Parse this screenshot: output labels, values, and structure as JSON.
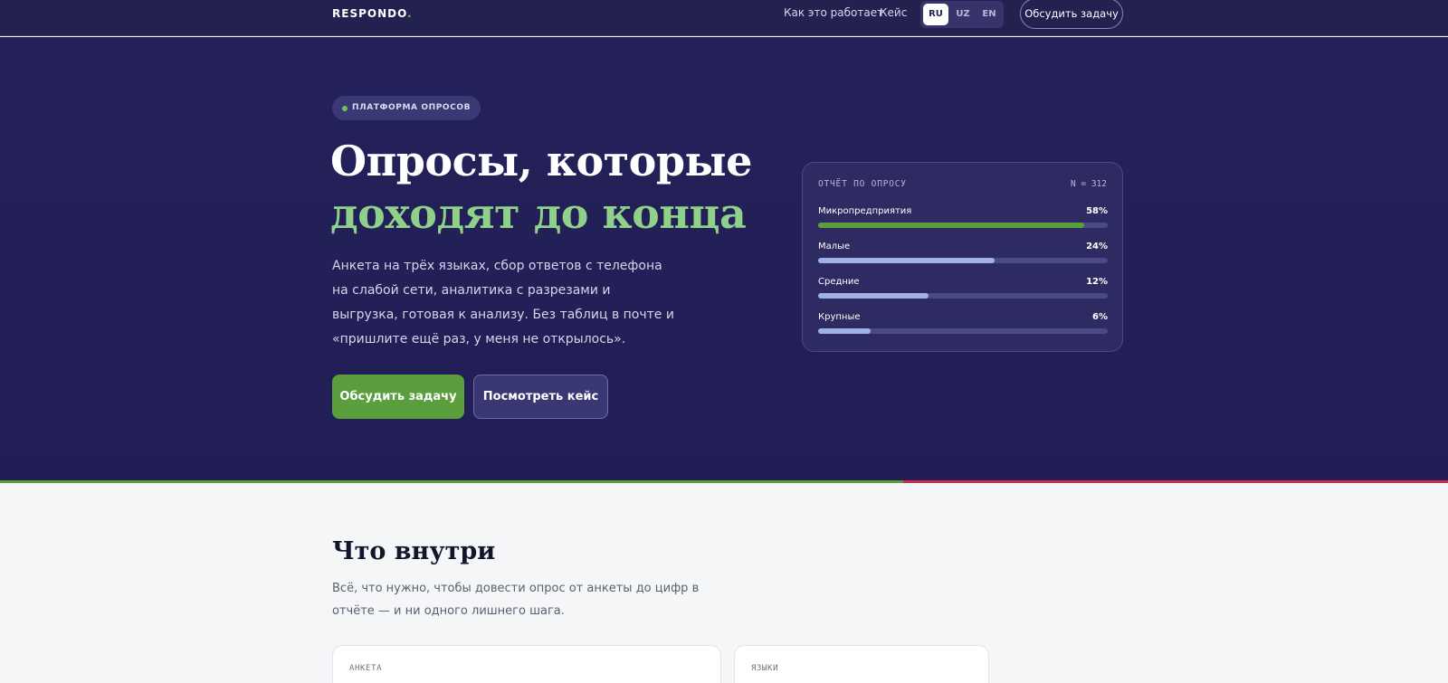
{
  "header": {
    "logo": "RESPONDO",
    "logo_dot": ".",
    "nav": [
      "Как это работает",
      "Кейс"
    ],
    "languages": [
      {
        "code": "RU",
        "active": true
      },
      {
        "code": "UZ",
        "active": false
      },
      {
        "code": "EN",
        "active": false
      }
    ],
    "cta": "Обсудить задачу"
  },
  "hero": {
    "badge": "ПЛАТФОРМА ОПРОСОВ",
    "headline_line1": "Опросы, которые",
    "headline_line2": "доходят до конца",
    "lead": "Анкета на трёх языках, сбор ответов с телефона на слабой сети, аналитика с разрезами и выгрузка, готовая к анализу. Без таблиц в почте и «пришлите ещё раз, у меня не открылось».",
    "primary_button": "Обсудить задачу",
    "secondary_button": "Посмотреть кейс"
  },
  "report": {
    "title": "ОТЧЁТ ПО ОПРОСУ",
    "n_label": "N = 312",
    "rows": [
      {
        "label": "Микропредприятия",
        "value": "58%",
        "fill_percent": 92,
        "color": "#5a9e3e"
      },
      {
        "label": "Малые",
        "value": "24%",
        "fill_percent": 61,
        "color": "#9fb2e6"
      },
      {
        "label": "Средние",
        "value": "12%",
        "fill_percent": 38,
        "color": "#9fb2e6"
      },
      {
        "label": "Крупные",
        "value": "6%",
        "fill_percent": 18,
        "color": "#9fb2e6"
      }
    ]
  },
  "features": {
    "title": "Что внутри",
    "subtitle": "Всё, что нужно, чтобы довести опрос от анкеты до цифр в отчёте — и ни одного лишнего шага.",
    "cards": [
      {
        "label": "АНКЕТА"
      },
      {
        "label": "ЯЗЫКИ"
      }
    ]
  },
  "colors": {
    "hero_bg": "#232150",
    "accent_green": "#5a9e3e",
    "headline_green": "#8fd08a",
    "divider_red": "#c8304a"
  }
}
